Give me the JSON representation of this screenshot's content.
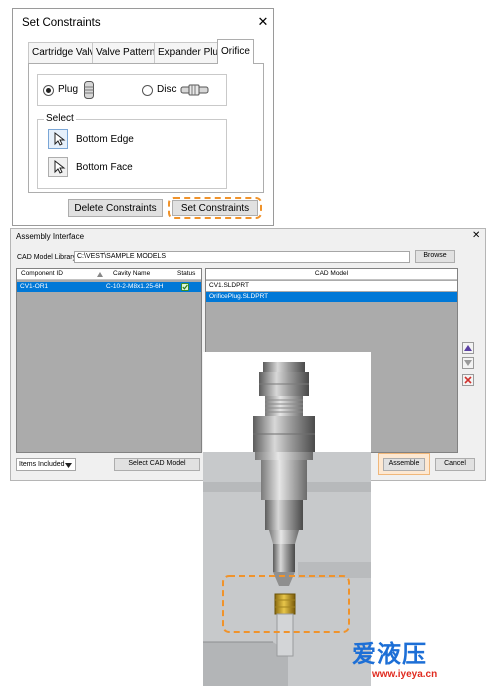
{
  "set_constraints": {
    "title": "Set Constraints",
    "close": "✕",
    "tabs": [
      {
        "label": "Cartridge Valve",
        "active": false
      },
      {
        "label": "Valve Pattern",
        "active": false
      },
      {
        "label": "Expander Plug",
        "active": false
      },
      {
        "label": "Orifice",
        "active": true
      }
    ],
    "type_options": [
      {
        "label": "Plug",
        "selected": true,
        "icon": "plug-icon"
      },
      {
        "label": "Disc",
        "selected": false,
        "icon": "disc-icon"
      }
    ],
    "select_group_label": "Select",
    "select_items": [
      {
        "label": "Bottom Edge",
        "icon": "cursor-arrow-icon",
        "active": true
      },
      {
        "label": "Bottom Face",
        "icon": "cursor-arrow-icon",
        "active": false
      }
    ],
    "delete_button": "Delete Constraints",
    "set_button": "Set Constraints",
    "highlight_color": "#f0932b"
  },
  "assembly_interface": {
    "title": "Assembly Interface",
    "close": "✕",
    "library_label": "CAD Model Library",
    "library_path": "C:\\VEST\\SAMPLE MODELS",
    "browse_button": "Browse",
    "components_table": {
      "columns": [
        "Component ID",
        "Cavity Name",
        "Status"
      ],
      "rows": [
        {
          "component_id": "CV1-OR1",
          "cavity_name": "C-10-2-M8x1.25-6H",
          "status": "ok",
          "selected": true
        }
      ]
    },
    "cad_model_table": {
      "column": "CAD Model",
      "rows": [
        {
          "name": "CV1.SLDPRT",
          "selected": false
        },
        {
          "name": "OrificePlug.SLDPRT",
          "selected": true
        }
      ]
    },
    "side_buttons": [
      "up-arrow-icon",
      "down-arrow-icon",
      "delete-x-icon"
    ],
    "filter_dropdown": "Items Included",
    "select_cad_button": "Select CAD Model",
    "assemble_button": "Assemble",
    "cancel_button": "Cancel",
    "selection_color": "#0078d7"
  },
  "watermark": {
    "logo": "爱液压",
    "url": "www.iyeya.cn"
  }
}
